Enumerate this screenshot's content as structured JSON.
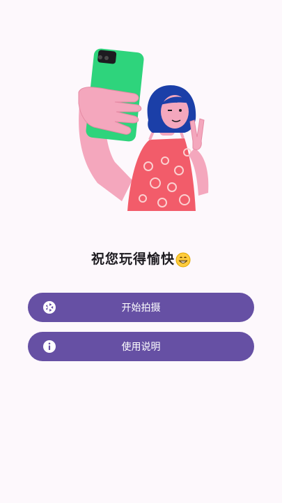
{
  "main": {
    "greeting": "祝您玩得愉快",
    "greeting_emoji": "grinning-face-icon",
    "buttons": [
      {
        "label": "开始拍摄",
        "icon": "camera-shutter-icon"
      },
      {
        "label": "使用说明",
        "icon": "info-icon"
      }
    ]
  },
  "colors": {
    "background": "#fdf8fc",
    "button": "#6650a4",
    "button_text": "#ffffff",
    "phone": "#2ed47c",
    "hand": "#f4a7bd",
    "dress": "#f25c6a",
    "hair": "#1b3fa8"
  }
}
